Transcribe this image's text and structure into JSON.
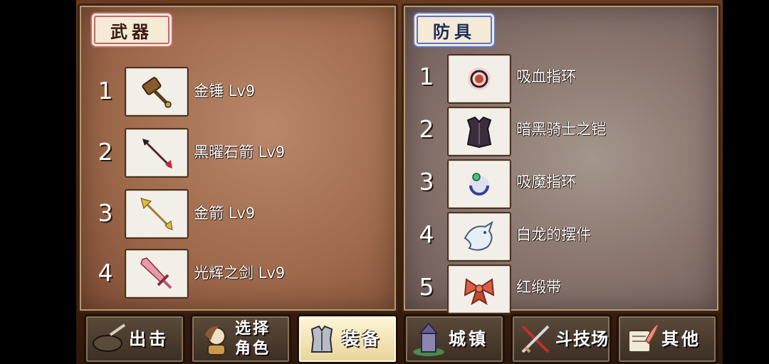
{
  "weapons": {
    "title": "武器",
    "items": [
      {
        "num": "1",
        "name": "金锤 Lv9",
        "icon": "golden-hammer-icon"
      },
      {
        "num": "2",
        "name": "黑曜石箭 Lv9",
        "icon": "obsidian-arrow-icon"
      },
      {
        "num": "3",
        "name": "金箭 Lv9",
        "icon": "golden-arrow-icon"
      },
      {
        "num": "4",
        "name": "光辉之剑 Lv9",
        "icon": "radiant-sword-icon"
      }
    ]
  },
  "armor": {
    "title": "防具",
    "items": [
      {
        "num": "1",
        "name": "吸血指环",
        "icon": "vampire-ring-icon"
      },
      {
        "num": "2",
        "name": "暗黑骑士之铠",
        "icon": "dark-knight-armor-icon"
      },
      {
        "num": "3",
        "name": "吸魔指环",
        "icon": "mana-ring-icon"
      },
      {
        "num": "4",
        "name": "白龙的摆件",
        "icon": "white-dragon-ornament-icon"
      },
      {
        "num": "5",
        "name": "红缎带",
        "icon": "red-ribbon-icon"
      }
    ]
  },
  "nav": {
    "sortie": "出击",
    "select_line1": "选择",
    "select_line2": "角色",
    "equipment": "装备",
    "town": "城镇",
    "arena": "斗技场",
    "other": "其他",
    "active": "equipment"
  },
  "colors": {
    "weapons_panel": "#a06a4c",
    "armor_panel": "#8a766e",
    "active_button": "#f2e4b4"
  }
}
